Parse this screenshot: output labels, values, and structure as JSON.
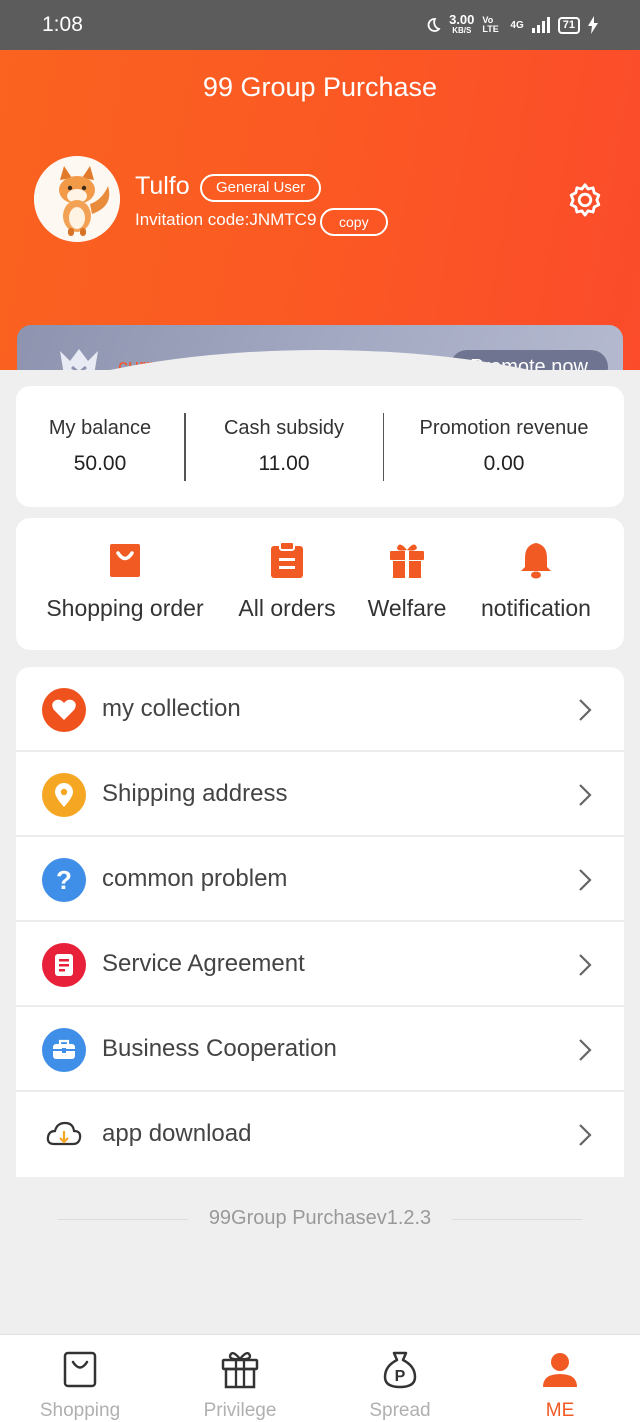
{
  "status_bar": {
    "time": "1:08",
    "net_speed": "3.00",
    "net_unit": "KB/S",
    "volte": "Vo LTE",
    "network": "4G",
    "battery": "71"
  },
  "header": {
    "title": "99 Group Purchase",
    "user_name": "Tulfo",
    "user_badge": "General User",
    "invitation": "Invitation code:JNMTC9",
    "copy_label": "copy"
  },
  "level": {
    "label": "current level",
    "promote_label": "Promote now"
  },
  "balances": [
    {
      "label": "My balance",
      "value": "50.00"
    },
    {
      "label": "Cash subsidy",
      "value": "11.00"
    },
    {
      "label": "Promotion revenue",
      "value": "0.00"
    }
  ],
  "shortcuts": [
    {
      "label": "Shopping order",
      "icon": "shopping-bag-icon"
    },
    {
      "label": "All orders",
      "icon": "clipboard-icon"
    },
    {
      "label": "Welfare",
      "icon": "gift-icon"
    },
    {
      "label": "notification",
      "icon": "bell-icon"
    }
  ],
  "menu": [
    {
      "label": "my collection",
      "icon": "heart-icon",
      "color": "#f0521e"
    },
    {
      "label": "Shipping address",
      "icon": "location-pin-icon",
      "color": "#f5a623"
    },
    {
      "label": "common problem",
      "icon": "question-icon",
      "color": "#3f8ee8"
    },
    {
      "label": "Service Agreement",
      "icon": "document-icon",
      "color": "#e8203a"
    },
    {
      "label": "Business Cooperation",
      "icon": "briefcase-icon",
      "color": "#3f8ee8"
    },
    {
      "label": "app download",
      "icon": "cloud-download-icon",
      "color": "#333333"
    }
  ],
  "version": "99Group Purchasev1.2.3",
  "tabs": [
    {
      "label": "Shopping",
      "icon": "shopping-bag-icon"
    },
    {
      "label": "Privilege",
      "icon": "gift-icon"
    },
    {
      "label": "Spread",
      "icon": "money-bag-icon"
    },
    {
      "label": "ME",
      "icon": "person-icon",
      "active": true
    }
  ],
  "colors": {
    "accent": "#f25a24",
    "header_start": "#fa6320",
    "header_end": "#fb4b2b",
    "level_card": "#a2a8c1"
  }
}
